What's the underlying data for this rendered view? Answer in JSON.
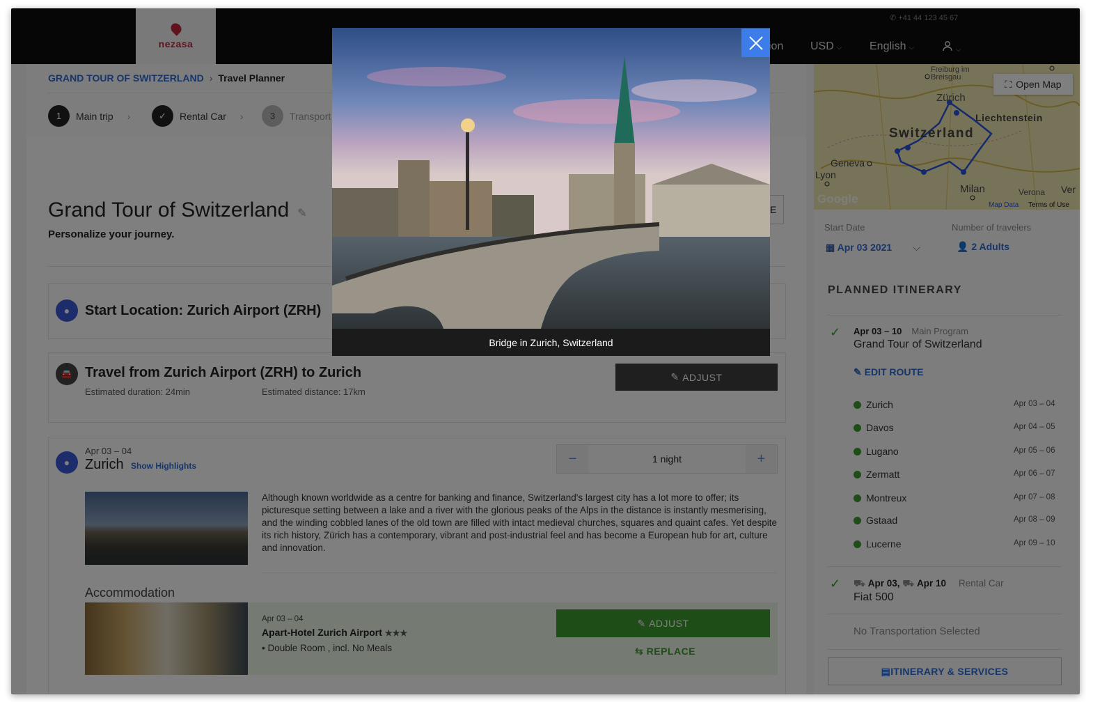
{
  "header": {
    "logo": "nezasa",
    "phone": "+41 44 123 45 67",
    "nav_partial": "ion",
    "currency": "USD",
    "language": "English"
  },
  "breadcrumb": {
    "root": "GRAND TOUR OF SWITZERLAND",
    "current": "Travel Planner"
  },
  "steps": [
    {
      "num": "1",
      "label": "Main trip"
    },
    {
      "num": "✓",
      "label": "Rental Car"
    },
    {
      "num": "3",
      "label": "Transport"
    }
  ],
  "trip": {
    "title": "Grand Tour of Switzerland",
    "subtitle": "Personalize your journey."
  },
  "start": {
    "label": "Start Location: Zurich Airport (ZRH)"
  },
  "travel": {
    "title": "Travel from Zurich Airport (ZRH) to Zurich",
    "duration": "Estimated duration: 24min",
    "distance": "Estimated distance: 17km",
    "adjust": "ADJUST"
  },
  "stop": {
    "dates": "Apr 03 – 04",
    "city": "Zurich",
    "highlights": "Show Highlights",
    "nights": "1 night",
    "description": "Although known worldwide as a centre for banking and finance, Switzerland's largest city has a lot more to offer; its picturesque setting between a lake and a river with the glorious peaks of the Alps in the distance is instantly mesmerising, and the winding cobbled lanes of the old town are filled with intact medieval churches, squares and quaint cafes. Yet despite its rich history, Zürich has a contemporary, vibrant and post-industrial feel and has become a European hub for art, culture and innovation."
  },
  "accommodation": {
    "heading": "Accommodation",
    "dates": "Apr 03 – 04",
    "hotel": "Apart-Hotel Zurich Airport",
    "stars": "★★★",
    "room": "• Double Room , incl. No Meals",
    "adjust": "ADJUST",
    "replace": "REPLACE"
  },
  "map": {
    "open_map": "Open Map",
    "labels": {
      "freiburg": "Freiburg im Breisgau",
      "zurich": "Zürich",
      "liechtenstein": "Liechtenstein",
      "switzerland": "Switzerland",
      "geneva": "Geneva",
      "lyon": "Lyon",
      "milan": "Milan",
      "verona": "Verona",
      "ver": "Ver",
      "google": "Google",
      "mapdata": "Map Data",
      "terms": "Terms of Use"
    }
  },
  "sidebar": {
    "start_date_label": "Start Date",
    "start_date": "Apr 03 2021",
    "travelers_label": "Number of travelers",
    "travelers": "2 Adults",
    "itinerary_heading": "PLANNED ITINERARY",
    "main": {
      "dates": "Apr 03 – 10",
      "tag": "Main Program",
      "title": "Grand Tour of Switzerland"
    },
    "edit_route": "EDIT ROUTE",
    "cities": [
      {
        "name": "Zurich",
        "dates": "Apr 03 – 04"
      },
      {
        "name": "Davos",
        "dates": "Apr 04 – 05"
      },
      {
        "name": "Lugano",
        "dates": "Apr 05 – 06"
      },
      {
        "name": "Zermatt",
        "dates": "Apr 06 – 07"
      },
      {
        "name": "Montreux",
        "dates": "Apr 07 – 08"
      },
      {
        "name": "Gstaad",
        "dates": "Apr 08 – 09"
      },
      {
        "name": "Lucerne",
        "dates": "Apr 09 – 10"
      }
    ],
    "car": {
      "from": "Apr 03,",
      "to": "Apr 10",
      "tag": "Rental Car",
      "model": "Fiat 500"
    },
    "no_transport": "No Transportation Selected",
    "itinerary_button": "ITINERARY & SERVICES"
  },
  "modal": {
    "caption": "Bridge in Zurich, Switzerland",
    "hidden_partial": "E"
  },
  "colors": {
    "accent": "#3d7de9",
    "link": "#2f6bd1",
    "green": "#3d9a2e",
    "brand": "#c0263a"
  }
}
